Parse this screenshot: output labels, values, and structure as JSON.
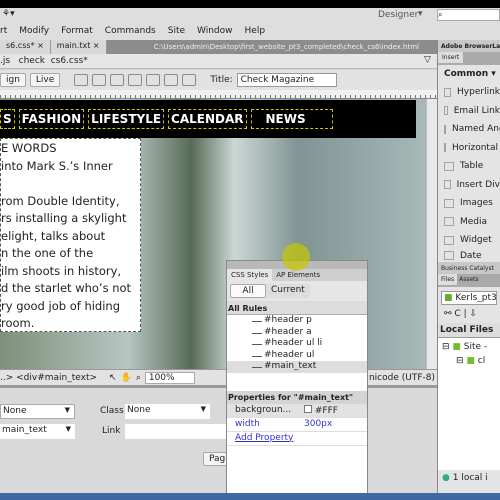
{
  "app": {
    "workspace": "Designer",
    "search_icon": "search-icon"
  },
  "menu": [
    "rt",
    "Modify",
    "Format",
    "Commands",
    "Site",
    "Window",
    "Help"
  ],
  "doc_tabs": [
    {
      "label": "s6.css*"
    },
    {
      "label": "main.txt"
    }
  ],
  "doc_path": "C:\\Users\\admin\\Desktop\\first_website_pt3_completed\\check_cs6\\index.html",
  "related_files": ".js   check  cs6.css*",
  "toolbar": {
    "design": "ign",
    "live": "Live",
    "title_label": "Title:",
    "title_value": "Check Magazine"
  },
  "nav": [
    "S",
    "FASHION",
    "LIFESTYLE",
    "CALENDAR",
    "NEWS"
  ],
  "main_text": [
    "E WORDS",
    " into Mark S.’s Inner",
    "",
    "rom Double Identity,",
    "rs installing a skylight",
    "elight, talks about",
    "n the one of the",
    "ilm shoots in history,",
    "d the starlet who’s not",
    "ry good job of hiding",
    "room."
  ],
  "status": {
    "tag": "..> <div#main_text>",
    "zoom": "100%",
    "encoding": "nicode (UTF-8)"
  },
  "properties": {
    "format": "None",
    "class_label": "Class",
    "class_value": "None",
    "id": "main_text",
    "link_label": "Link",
    "link_value": "",
    "page_button": "Page"
  },
  "css_panel": {
    "tabs": [
      "CSS Styles",
      "AP Elements"
    ],
    "all": "All",
    "current": "Current",
    "all_rules": "All Rules",
    "rules": [
      "#header p",
      "#header a",
      "#header ul li",
      "#header ul",
      "#main_text"
    ],
    "props_for": "Properties for \"#main_text\"",
    "props": [
      {
        "name": "backgroun...",
        "value": "#FFF"
      },
      {
        "name": "width",
        "value": "300px"
      }
    ],
    "add_property": "Add Property"
  },
  "right_panel": {
    "title": "Adobe BrowserLab",
    "insert_tab": "Insert",
    "category": "Common",
    "items": [
      "Hyperlink",
      "Email Link",
      "Named Anchor",
      "Horizontal Rule",
      "Table",
      "Insert Div",
      "Images",
      "Media",
      "Widget",
      "Date"
    ],
    "bc": "Business Catalyst",
    "files_tabs": [
      "Files",
      "Assets"
    ],
    "site": "Kerls_pt3",
    "local_files": "Local Files",
    "tree": [
      "Site -",
      "cl"
    ],
    "status": "1 local i"
  }
}
